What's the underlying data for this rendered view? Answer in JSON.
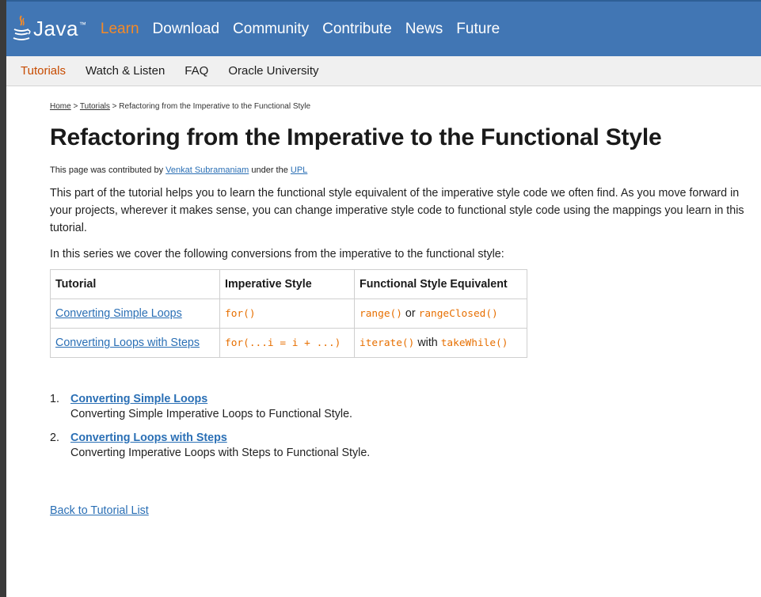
{
  "brand": {
    "logo_text": "Java",
    "trademark": "™"
  },
  "top_nav": [
    {
      "label": "Learn",
      "active": true
    },
    {
      "label": "Download",
      "active": false
    },
    {
      "label": "Community",
      "active": false
    },
    {
      "label": "Contribute",
      "active": false
    },
    {
      "label": "News",
      "active": false
    },
    {
      "label": "Future",
      "active": false
    }
  ],
  "sub_nav": [
    {
      "label": "Tutorials",
      "active": true
    },
    {
      "label": "Watch & Listen",
      "active": false
    },
    {
      "label": "FAQ",
      "active": false
    },
    {
      "label": "Oracle University",
      "active": false
    }
  ],
  "breadcrumb": {
    "home": "Home",
    "sep1": " > ",
    "tutorials": "Tutorials",
    "sep2": " > ",
    "current": "Refactoring from the Imperative to the Functional Style"
  },
  "page_title": "Refactoring from the Imperative to the Functional Style",
  "contribution": {
    "prefix": "This page was contributed by ",
    "author": "Venkat Subramaniam",
    "middle": " under the ",
    "license": "UPL"
  },
  "intro": "This part of the tutorial helps you to learn the functional style equivalent of the imperative style code we often find. As you move forward in your projects, wherever it makes sense, you can change imperative style code to functional style code using the mappings you learn in this tutorial.",
  "series_intro": "In this series we cover the following conversions from the imperative to the functional style:",
  "table": {
    "headers": [
      "Tutorial",
      "Imperative Style",
      "Functional Style Equivalent"
    ],
    "rows": [
      {
        "tutorial": "Converting Simple Loops",
        "imperative": "for()",
        "func_code1": "range()",
        "func_joiner": " or ",
        "func_code2": "rangeClosed()"
      },
      {
        "tutorial": "Converting Loops with Steps",
        "imperative": "for(...i = i + ...)",
        "func_code1": "iterate()",
        "func_joiner": " with ",
        "func_code2": "takeWhile()"
      }
    ]
  },
  "list": [
    {
      "number": "1.",
      "title": "Converting Simple Loops",
      "description": "Converting Simple Imperative Loops to Functional Style."
    },
    {
      "number": "2.",
      "title": "Converting Loops with Steps",
      "description": "Converting Imperative Loops with Steps to Functional Style."
    }
  ],
  "back_link": "Back to Tutorial List",
  "colors": {
    "header_blue": "#4176b4",
    "accent_orange": "#f58a27",
    "link_blue": "#2a6fb5",
    "code_orange": "#e76f00"
  }
}
